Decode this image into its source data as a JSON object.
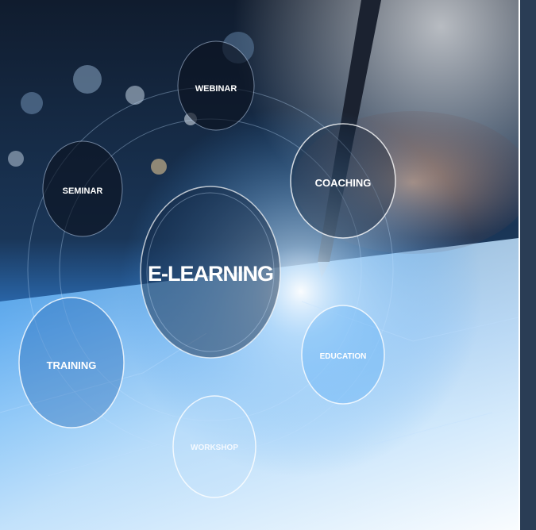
{
  "labels": {
    "center": "E-LEARNING",
    "webinar": "WEBINAR",
    "seminar": "SEMINAR",
    "coaching": "COACHING",
    "training": "TRAINING",
    "education": "EDUCATION",
    "workshop": "WORKSHOP"
  },
  "colors": {
    "sidebar": "#2a3d55",
    "glow": "#ffffff",
    "deep_blue": "#0c1f40",
    "bright_blue": "#3f9bf0"
  }
}
